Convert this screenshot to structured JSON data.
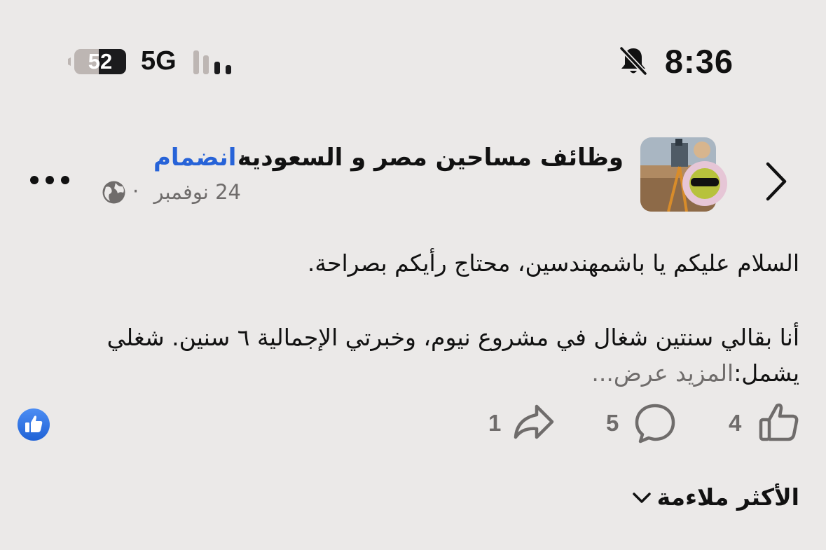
{
  "status_bar": {
    "time": "8:36",
    "battery": "52",
    "network": "5G"
  },
  "post": {
    "group_name": "وظائف مساحين مصر و السعوديه",
    "separator": "·",
    "join_label": "انضمام",
    "date": "24 نوفمبر",
    "date_separator": "·",
    "line1": "السلام عليكم يا باشمهندسين، محتاج رأيكم بصراحة.",
    "line2": "أنا بقالي سنتين شغال في مشروع نيوم، وخبرتي الإجمالية ٦ سنين. شغلي",
    "line3": "يشمل:",
    "see_more": "المزيد عرض..."
  },
  "actions": {
    "likes": "4",
    "comments": "5",
    "shares": "1"
  },
  "comments_sort": {
    "label": "الأكثر ملاءمة"
  },
  "icons": [
    "battery-icon",
    "signal-icon",
    "bell-off-icon",
    "back-chevron-icon",
    "globe-icon",
    "more-icon",
    "like-icon",
    "comment-icon",
    "share-icon",
    "like-reaction-icon",
    "chevron-down-icon"
  ],
  "colors": {
    "accent": "#2763d8",
    "background": "#ebe9e8",
    "secondary_text": "#6f6c6b",
    "reaction_blue": "#2f74e8"
  }
}
